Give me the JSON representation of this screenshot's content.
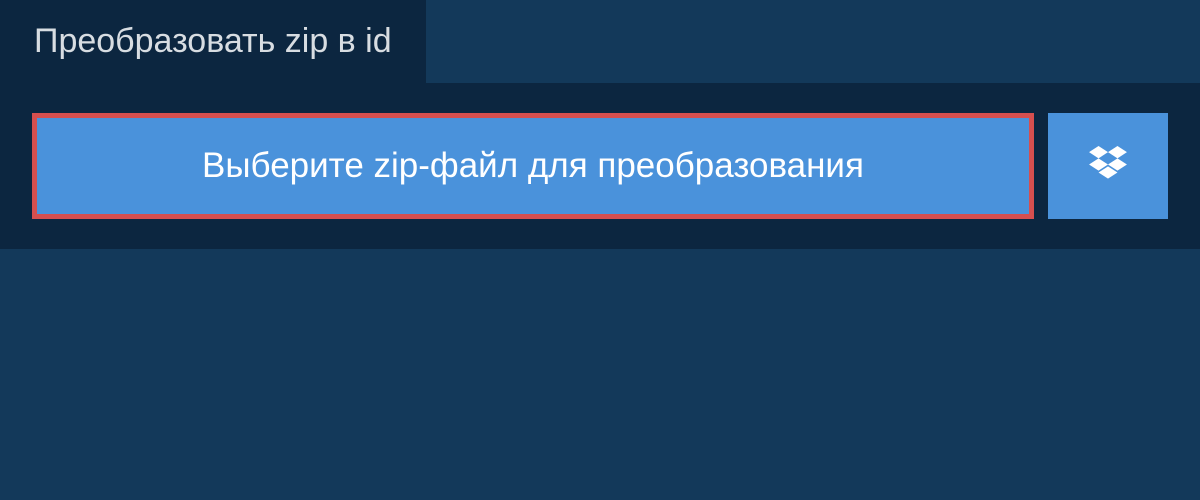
{
  "tab": {
    "label": "Преобразовать zip в id"
  },
  "upload": {
    "select_button_label": "Выберите zip-файл для преобразования"
  },
  "colors": {
    "background": "#13395a",
    "panel": "#0c2640",
    "button": "#4a92db",
    "button_border": "#d64f4f",
    "text_light": "#d8dde2",
    "text_white": "#ffffff"
  }
}
